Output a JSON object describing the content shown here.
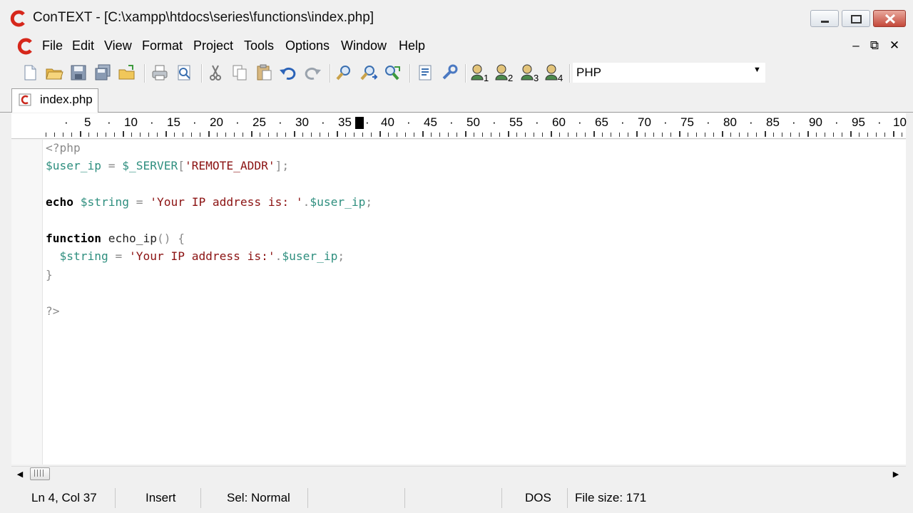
{
  "window": {
    "title": "ConTEXT - [C:\\xampp\\htdocs\\series\\functions\\index.php]",
    "app_icon": "context-c-logo"
  },
  "menu": {
    "items": [
      "File",
      "Edit",
      "View",
      "Format",
      "Project",
      "Tools",
      "Options",
      "Window",
      "Help"
    ],
    "mdi_controls": [
      "–",
      "⧉",
      "✕"
    ]
  },
  "toolbar": {
    "buttons": [
      "new-file-icon",
      "open-folder-icon",
      "save-icon",
      "save-all-icon",
      "open-project-icon",
      "print-icon",
      "print-preview-icon",
      "cut-icon",
      "copy-icon",
      "paste-icon",
      "undo-icon",
      "redo-icon",
      "find-icon",
      "find-next-icon",
      "replace-icon",
      "file-info-icon",
      "settings-icon",
      "user-command-1-icon",
      "user-command-2-icon",
      "user-command-3-icon",
      "user-command-4-icon"
    ],
    "language": "PHP"
  },
  "tab": {
    "label": "index.php",
    "icon": "php-file-icon"
  },
  "ruler": {
    "numbers": [
      "5",
      "10",
      "15",
      "20",
      "25",
      "30",
      "35",
      "40",
      "45",
      "50",
      "55",
      "60",
      "65",
      "70",
      "75",
      "80",
      "85",
      "90",
      "95",
      "10"
    ]
  },
  "code": {
    "line1": {
      "tag": "<?php"
    },
    "line2": {
      "var": "$user_ip",
      "eq": " = ",
      "server": "$_SERVER",
      "b1": "[",
      "key": "'REMOTE_ADDR'",
      "b2": "];"
    },
    "line4": {
      "kw": "echo",
      "sp": " ",
      "var": "$string",
      "eq": " = ",
      "str": "'Your IP address is: '",
      "dot": ".",
      "var2": "$user_ip",
      "semi": ";"
    },
    "line6": {
      "kw": "function",
      "sp": " ",
      "name": "echo_ip",
      "parens": "() {"
    },
    "line7": {
      "indent": "  ",
      "var": "$string",
      "eq": " = ",
      "str": "'Your IP address is:'",
      "dot": ".",
      "var2": "$user_ip",
      "semi": ";"
    },
    "line8": {
      "brace": "}"
    },
    "line10": {
      "tag": "?>"
    }
  },
  "status": {
    "position": "Ln 4, Col 37",
    "mode": "Insert",
    "selection": "Sel: Normal",
    "format": "DOS",
    "filesize": "File size: 171"
  },
  "colors": {
    "keyword": "#000000",
    "variable": "#2f8f7f",
    "string": "#8b1212",
    "punctuation": "#8a8a8a"
  }
}
